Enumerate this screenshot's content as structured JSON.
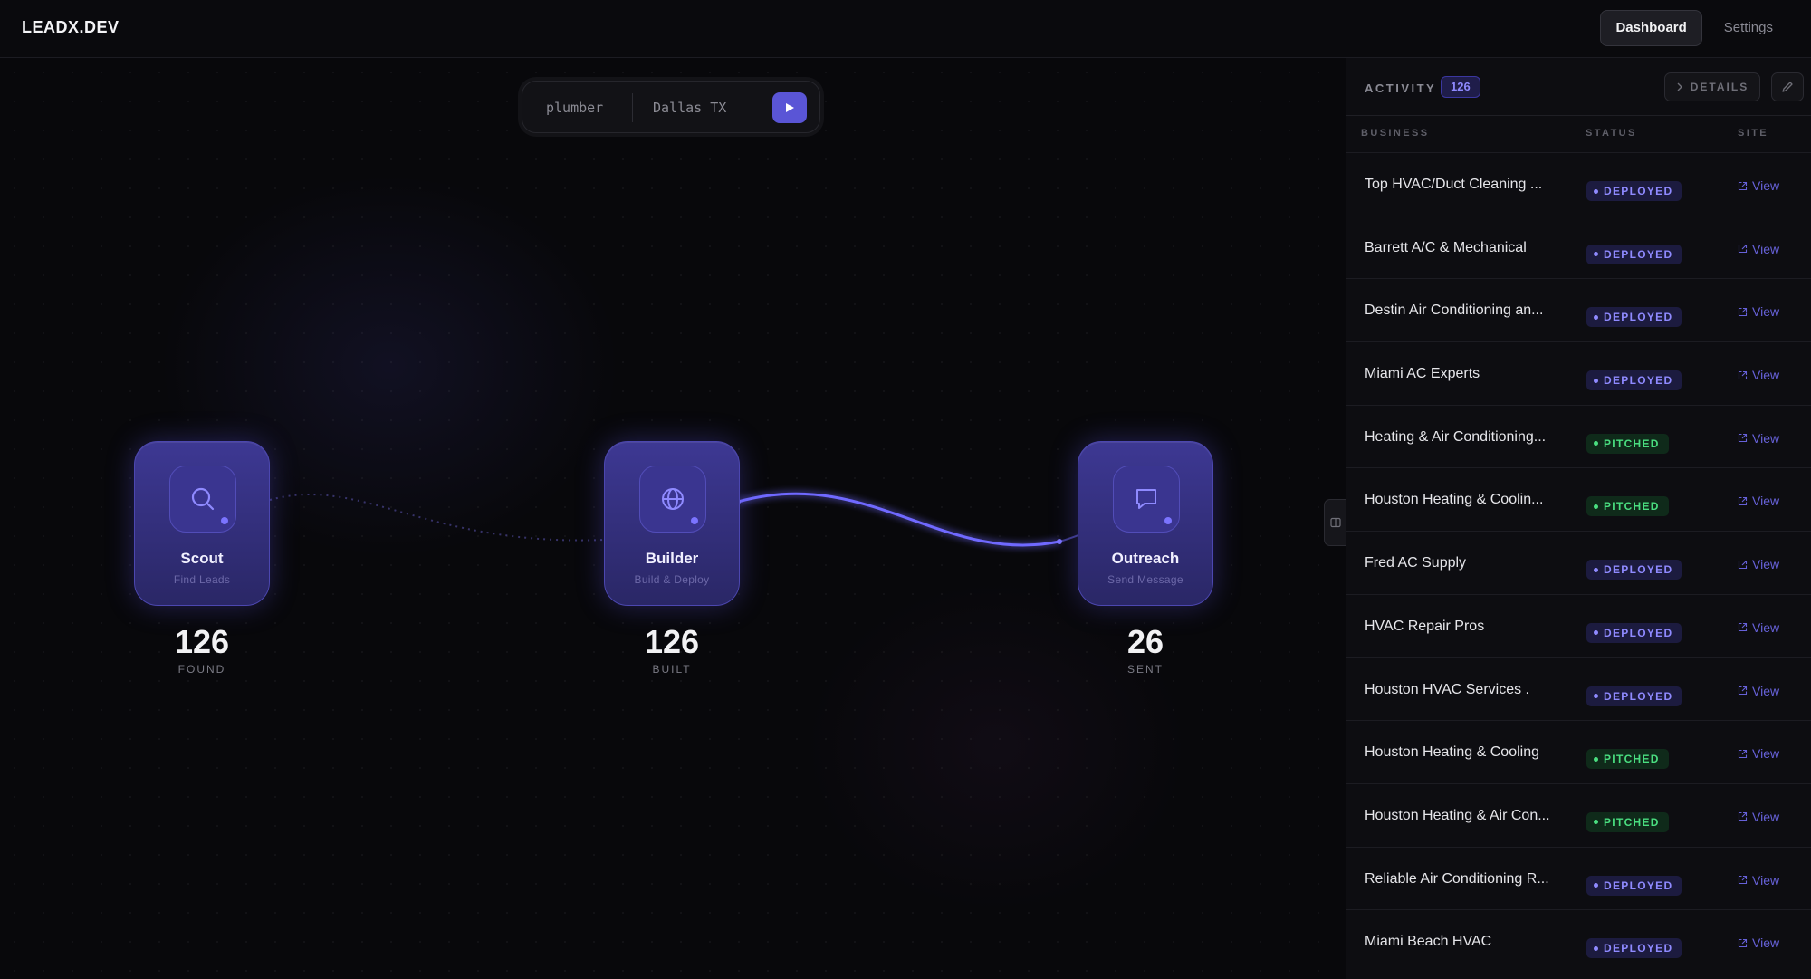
{
  "app": {
    "brand": "LEADX.DEV",
    "nav": {
      "dashboard": "Dashboard",
      "settings": "Settings"
    }
  },
  "search": {
    "keyword_placeholder": "plumber",
    "location_placeholder": "Dallas TX"
  },
  "pipeline": {
    "scout": {
      "title": "Scout",
      "subtitle": "Find Leads",
      "count": "126",
      "count_label": "FOUND"
    },
    "builder": {
      "title": "Builder",
      "subtitle": "Build & Deploy",
      "count": "126",
      "count_label": "BUILT"
    },
    "outreach": {
      "title": "Outreach",
      "subtitle": "Send Message",
      "count": "26",
      "count_label": "SENT"
    }
  },
  "activity": {
    "title": "ACTIVITY",
    "count": "126",
    "details_label": "DETAILS",
    "columns": {
      "business": "BUSINESS",
      "status": "STATUS",
      "site": "SITE"
    },
    "rows": [
      {
        "business": "Top HVAC/Duct Cleaning ...",
        "status": "DEPLOYED",
        "site": "View"
      },
      {
        "business": "Barrett A/C & Mechanical",
        "status": "DEPLOYED",
        "site": "View"
      },
      {
        "business": "Destin Air Conditioning an...",
        "status": "DEPLOYED",
        "site": "View"
      },
      {
        "business": "Miami AC Experts",
        "status": "DEPLOYED",
        "site": "View"
      },
      {
        "business": "Heating & Air Conditioning...",
        "status": "PITCHED",
        "site": "View"
      },
      {
        "business": "Houston Heating & Coolin...",
        "status": "PITCHED",
        "site": "View"
      },
      {
        "business": "Fred AC Supply",
        "status": "DEPLOYED",
        "site": "View"
      },
      {
        "business": "HVAC Repair Pros",
        "status": "DEPLOYED",
        "site": "View"
      },
      {
        "business": "Houston HVAC Services .",
        "status": "DEPLOYED",
        "site": "View"
      },
      {
        "business": "Houston Heating & Cooling",
        "status": "PITCHED",
        "site": "View"
      },
      {
        "business": "Houston Heating & Air Con...",
        "status": "PITCHED",
        "site": "View"
      },
      {
        "business": "Reliable Air Conditioning R...",
        "status": "DEPLOYED",
        "site": "View"
      },
      {
        "business": "Miami Beach HVAC",
        "status": "DEPLOYED",
        "site": "View"
      }
    ]
  },
  "colors": {
    "accent": "#5a55d6",
    "deployed": "#8f8aff",
    "pitched": "#4ade80",
    "background": "#08080b"
  }
}
